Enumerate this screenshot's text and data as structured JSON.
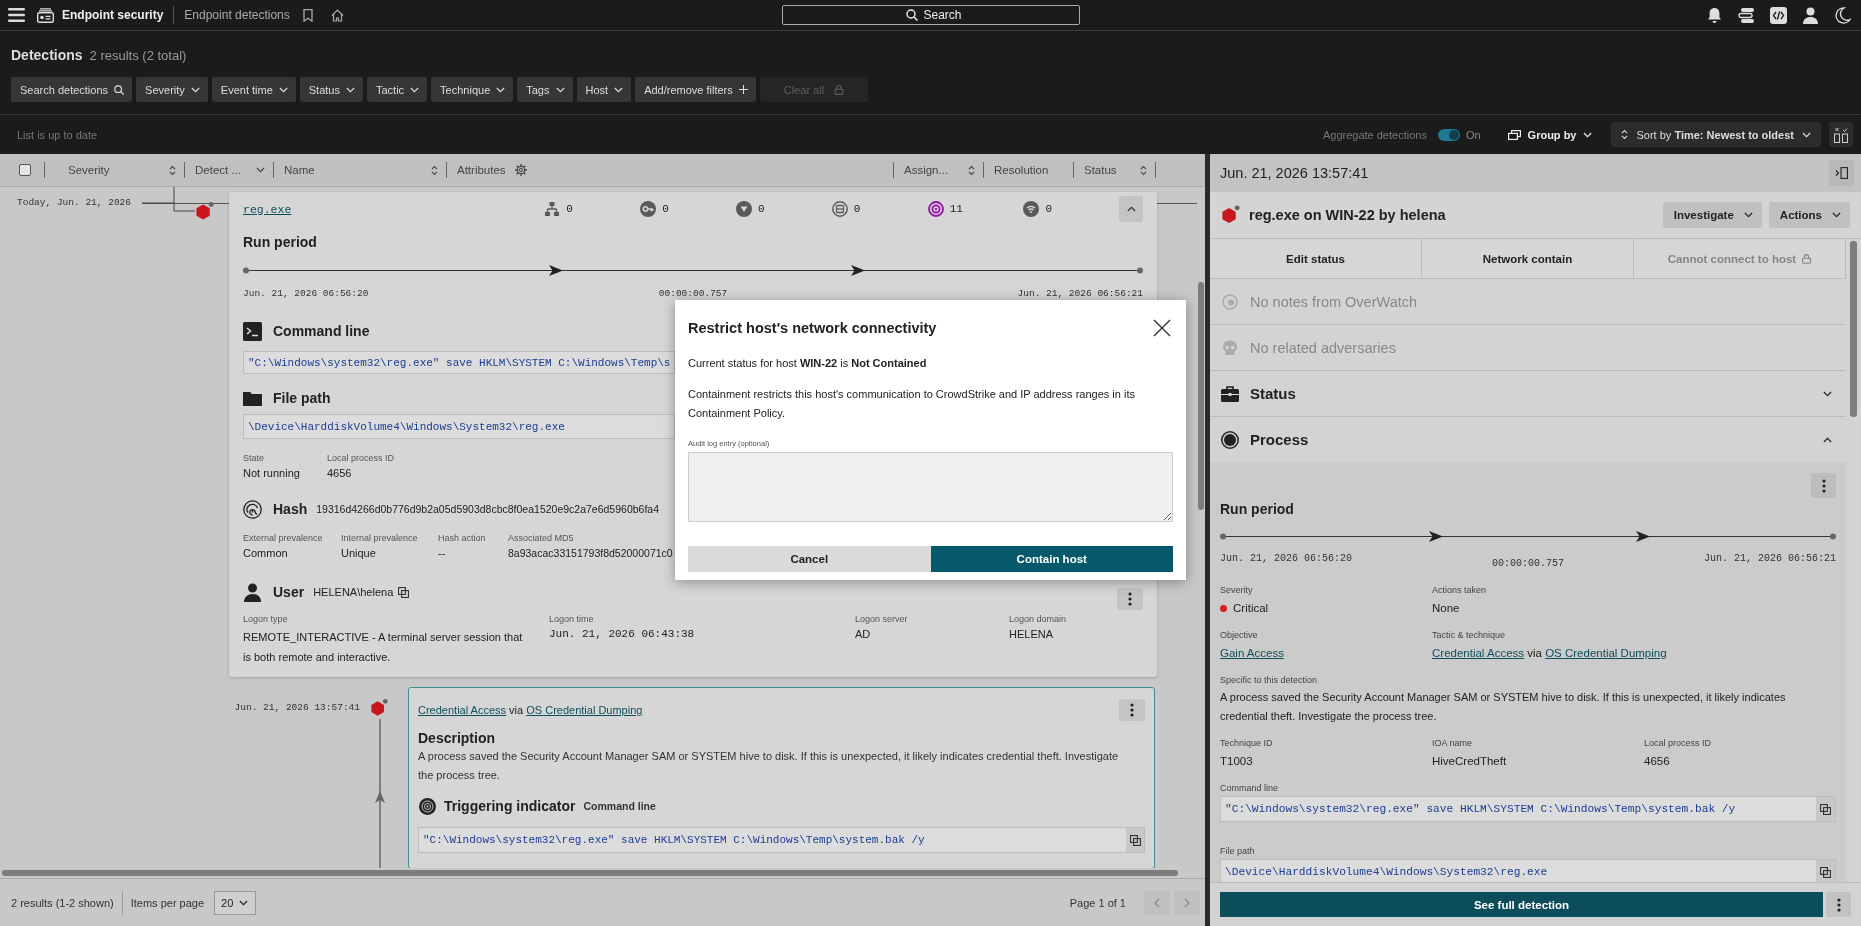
{
  "top_bar": {
    "app_name": "Endpoint security",
    "breadcrumb": "Endpoint detections",
    "search": {
      "placeholder": "Search"
    }
  },
  "page_header": {
    "title": "Detections",
    "count": "2 results (2 total)"
  },
  "filters": [
    {
      "label": "Search detections",
      "kind": "search",
      "disabled": false
    },
    {
      "label": "Severity",
      "kind": "dropdown",
      "disabled": false
    },
    {
      "label": "Event time",
      "kind": "dropdown",
      "disabled": false
    },
    {
      "label": "Status",
      "kind": "dropdown",
      "disabled": false
    },
    {
      "label": "Tactic",
      "kind": "dropdown",
      "disabled": false
    },
    {
      "label": "Technique",
      "kind": "dropdown",
      "disabled": false
    },
    {
      "label": "Tags",
      "kind": "dropdown",
      "disabled": false
    },
    {
      "label": "Host",
      "kind": "dropdown",
      "disabled": false
    },
    {
      "label": "Add/remove filters",
      "kind": "add",
      "disabled": false
    },
    {
      "label": "Clear all",
      "kind": "lock",
      "disabled": true
    }
  ],
  "list_toolbar": {
    "status": "List is up to date",
    "aggregate": {
      "label": "Aggregate detections",
      "on": true,
      "state_label": "On"
    },
    "group_by": "Group by",
    "sort": "Sort by **Time: Newest to oldest**"
  },
  "table_header": {
    "select_all": {
      "checked": false
    },
    "columns": [
      {
        "label": "Severity",
        "kind": "sort"
      },
      {
        "label": "Detect ...",
        "kind": "menu"
      },
      {
        "label": "Name",
        "kind": "sort"
      },
      {
        "label": "Attributes",
        "kind": "settings"
      },
      {
        "label": "Assign...",
        "kind": "sort"
      },
      {
        "label": "Resolution",
        "kind": "plain"
      },
      {
        "label": "Status",
        "kind": "sort"
      }
    ]
  },
  "process_card": {
    "date": "Today, Jun. 21, 2026",
    "name": "reg.exe",
    "expanded": true,
    "attributes": [
      {
        "kind": "tree",
        "count": "0",
        "active": false
      },
      {
        "kind": "key",
        "count": "0",
        "active": false
      },
      {
        "kind": "triangle",
        "count": "0",
        "active": false
      },
      {
        "kind": "drive",
        "count": "0",
        "active": false
      },
      {
        "kind": "target",
        "count": "11",
        "active": true
      },
      {
        "kind": "signal",
        "count": "0",
        "active": false
      }
    ],
    "run_period": {
      "title": "Run period",
      "start": "Jun. 21, 2026 06:56:20",
      "duration": "00:00:00.757",
      "end": "Jun. 21, 2026 06:56:21"
    },
    "command_line": {
      "title": "Command line",
      "value": "\"C:\\Windows\\system32\\reg.exe\" save HKLM\\SYSTEM C:\\Windows\\Temp\\s"
    },
    "file_path": {
      "title": "File path",
      "value": "\\Device\\HarddiskVolume4\\Windows\\System32\\reg.exe"
    },
    "process_fields": [
      {
        "label": "State",
        "value": "Not running"
      },
      {
        "label": "Local process ID",
        "value": "4656"
      }
    ],
    "hash": {
      "title": "Hash",
      "value": "19316d4266d0b776d9b2a05d5903d8cbc8f0ea1520e9c2a7e6d5960b6fa4",
      "fields": [
        {
          "label": "External prevalence",
          "value": "Common"
        },
        {
          "label": "Internal prevalence",
          "value": "Unique"
        },
        {
          "label": "Hash action",
          "value": "--"
        },
        {
          "label": "Associated MD5",
          "value": "8a93acac33151793f8d52000071c0"
        }
      ]
    },
    "user": {
      "title": "User",
      "value": "HELENA\\helena",
      "fields": [
        {
          "label": "Logon type",
          "value": "REMOTE_INTERACTIVE - A terminal server session that is both remote and interactive.",
          "kind": "text"
        },
        {
          "label": "Logon time",
          "value": "Jun. 21, 2026 06:43:38",
          "kind": "mono"
        },
        {
          "label": "Logon server",
          "value": "AD",
          "kind": "text"
        },
        {
          "label": "Logon domain",
          "value": "HELENA",
          "kind": "text"
        }
      ]
    }
  },
  "detection_card": {
    "time": "Jun. 21, 2026 13:57:41",
    "tactic": "Credential Access",
    "joiner": "via",
    "technique": "OS Credential Dumping",
    "description_title": "Description",
    "description": "A process saved the Security Account Manager SAM or SYSTEM hive to disk. If this is unexpected, it likely indicates credential theft. Investigate the process tree.",
    "indicator": {
      "title": "Triggering indicator",
      "type": "Command line",
      "value": "\"C:\\Windows\\system32\\reg.exe\" save HKLM\\SYSTEM C:\\Windows\\Temp\\system.bak /y"
    }
  },
  "footer": {
    "summary": "2 results (1-2 shown)",
    "items_per_page_label": "Items per page",
    "items_per_page": "20",
    "page": "Page 1 of 1"
  },
  "detail_panel": {
    "time": "Jun. 21, 2026 13:57:41",
    "title": "reg.exe on WIN-22 by helena",
    "menus": [
      "Investigate",
      "Actions"
    ],
    "actions": [
      {
        "label": "Edit status",
        "disabled": false
      },
      {
        "label": "Network contain",
        "disabled": false
      },
      {
        "label": "Cannot connect to host",
        "disabled": true
      }
    ],
    "notices": [
      {
        "kind": "overwatch",
        "text": "No notes from OverWatch"
      },
      {
        "kind": "adversary",
        "text": "No related adversaries"
      }
    ],
    "sections": [
      {
        "kind": "status",
        "title": "Status",
        "expanded": false
      },
      {
        "kind": "process",
        "title": "Process",
        "expanded": true
      }
    ],
    "process": {
      "run_period": {
        "title": "Run period",
        "start": "Jun. 21, 2026 06:56:20",
        "duration": "00:00:00.757",
        "end": "Jun. 21, 2026 06:56:21"
      },
      "fields": [
        {
          "kind": "status",
          "label": "Severity",
          "value": "Critical",
          "color": "#d81e1e"
        },
        {
          "kind": "text",
          "label": "Actions taken",
          "value": "None"
        },
        {
          "kind": "link",
          "label": "Objective",
          "value": "Gain Access"
        },
        {
          "kind": "tactic",
          "label": "Tactic & technique",
          "tactic": "Credential Access",
          "joiner": "via",
          "technique": "OS Credential Dumping"
        }
      ],
      "specific": {
        "label": "Specific to this detection",
        "value": "A process saved the Security Account Manager SAM or SYSTEM hive to disk. If this is unexpected, it likely indicates credential theft. Investigate the process tree."
      },
      "ids": [
        {
          "label": "Technique ID",
          "value": "T1003"
        },
        {
          "label": "IOA name",
          "value": "HiveCredTheft"
        },
        {
          "label": "Local process ID",
          "value": "4656"
        }
      ],
      "command_line": {
        "label": "Command line",
        "value": "\"C:\\Windows\\system32\\reg.exe\" save HKLM\\SYSTEM C:\\Windows\\Temp\\system.bak /y"
      },
      "file_path": {
        "label": "File path",
        "value": "\\Device\\HarddiskVolume4\\Windows\\System32\\reg.exe"
      }
    },
    "primary_action": "See full detection"
  },
  "modal": {
    "title": "Restrict host's network connectivity",
    "status": "Current status for host **WIN-22** is **Not Contained**",
    "body": "Containment restricts this host's communication to CrowdStrike and IP address ranges in its Containment Policy.",
    "audit": {
      "label": "Audit log entry (optional)"
    },
    "buttons": [
      {
        "label": "Cancel",
        "kind": "secondary"
      },
      {
        "label": "Contain host",
        "kind": "primary"
      }
    ]
  }
}
